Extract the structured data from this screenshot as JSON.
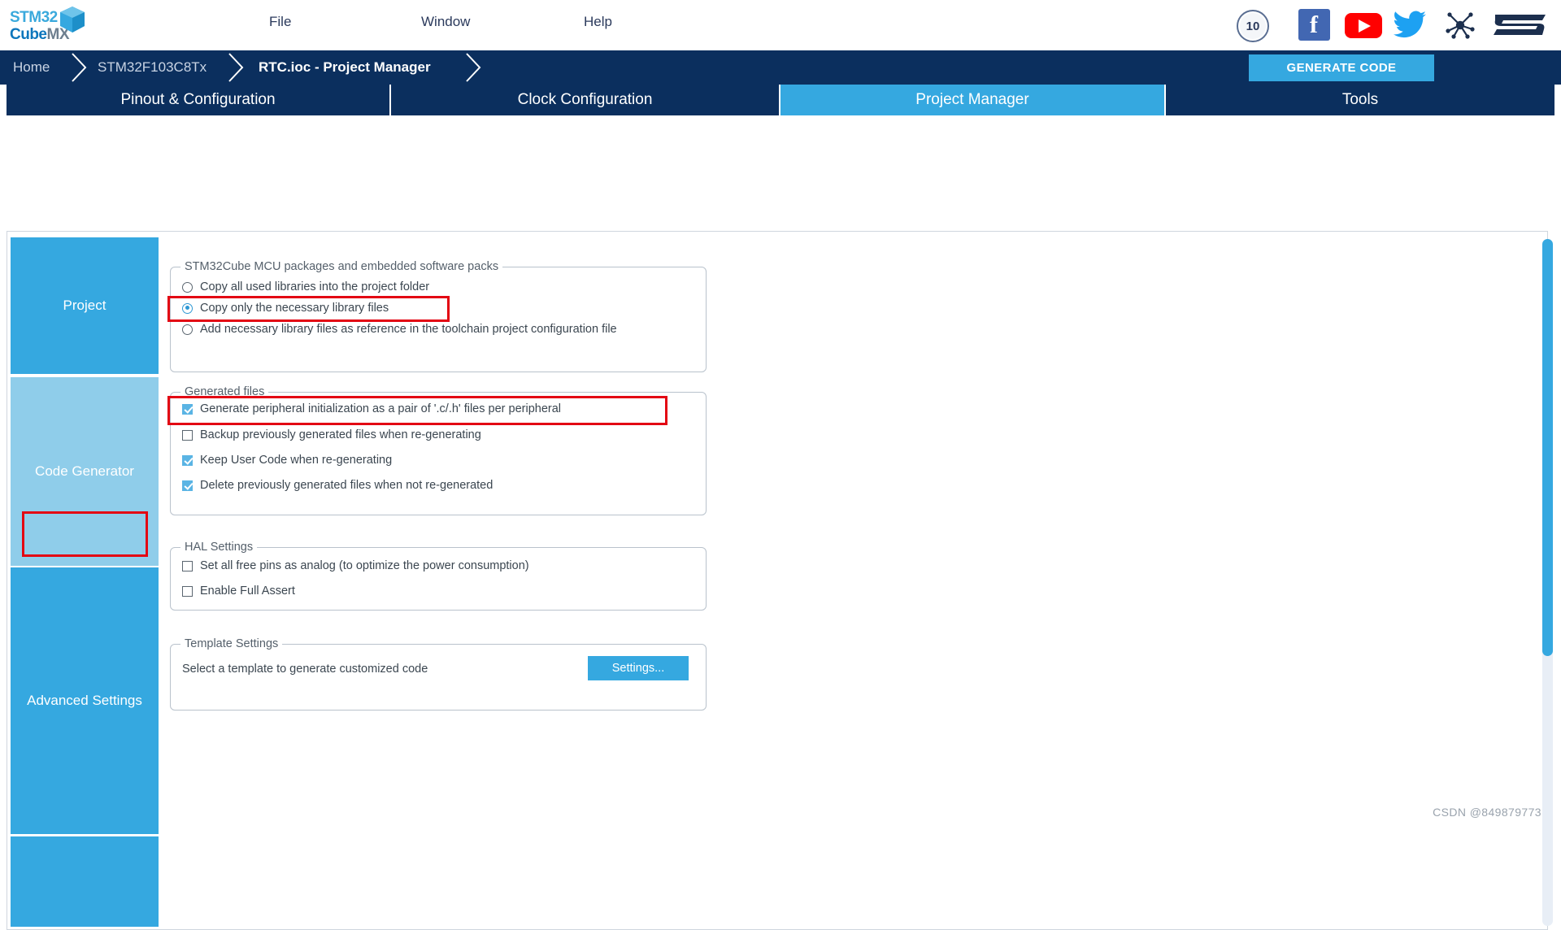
{
  "app": {
    "logo_line1": "STM32",
    "logo_line2_bold": "Cube",
    "logo_line2_light": "MX",
    "title": "STM32CubeMX"
  },
  "menubar": {
    "items": [
      {
        "label": "File",
        "name": "menu-file"
      },
      {
        "label": "Window",
        "name": "menu-window"
      },
      {
        "label": "Help",
        "name": "menu-help"
      }
    ],
    "icons": [
      {
        "name": "anniversary-10-badge-icon",
        "label": "10"
      },
      {
        "name": "facebook-icon",
        "label": "f"
      },
      {
        "name": "youtube-icon",
        "label": ""
      },
      {
        "name": "twitter-icon",
        "label": ""
      },
      {
        "name": "st-community-icon",
        "label": ""
      },
      {
        "name": "st-logo-icon",
        "label": ""
      }
    ]
  },
  "breadcrumb": {
    "items": [
      {
        "label": "Home",
        "active": false
      },
      {
        "label": "STM32F103C8Tx",
        "active": false
      },
      {
        "label": "RTC.ioc - Project Manager",
        "active": true
      }
    ],
    "generate_code_label": "GENERATE CODE"
  },
  "tabs": [
    {
      "label": "Pinout & Configuration",
      "selected": false
    },
    {
      "label": "Clock Configuration",
      "selected": false
    },
    {
      "label": "Project Manager",
      "selected": true
    },
    {
      "label": "Tools",
      "selected": false
    }
  ],
  "sidebar": {
    "items": [
      {
        "label": "Project",
        "selected": false
      },
      {
        "label": "Code Generator",
        "selected": true
      },
      {
        "label": "Advanced Settings",
        "selected": false
      }
    ]
  },
  "panels": {
    "mcu_packages": {
      "title": "STM32Cube MCU packages and embedded software packs",
      "options": [
        {
          "label": "Copy all used libraries into the project folder",
          "checked": false
        },
        {
          "label": "Copy only the necessary library files",
          "checked": true
        },
        {
          "label": "Add necessary library files as reference in the toolchain project configuration file",
          "checked": false
        }
      ]
    },
    "generated_files": {
      "title": "Generated files",
      "options": [
        {
          "label": "Generate peripheral initialization as a pair of '.c/.h' files per peripheral",
          "checked": true
        },
        {
          "label": "Backup previously generated files when re-generating",
          "checked": false
        },
        {
          "label": "Keep User Code when re-generating",
          "checked": true
        },
        {
          "label": "Delete previously generated files when not re-generated",
          "checked": true
        }
      ]
    },
    "hal_settings": {
      "title": "HAL Settings",
      "options": [
        {
          "label": "Set all free pins as analog (to optimize the power consumption)",
          "checked": false
        },
        {
          "label": "Enable Full Assert",
          "checked": false
        }
      ]
    },
    "template_settings": {
      "title": "Template Settings",
      "description": "Select a template to generate customized code",
      "button_label": "Settings..."
    }
  },
  "colors": {
    "accent_blue": "#35a8e0",
    "dark_navy": "#0b2f5e",
    "highlight_red": "#e30613",
    "sidebar_selected": "#8fcdea"
  },
  "watermark": "CSDN @849879773"
}
